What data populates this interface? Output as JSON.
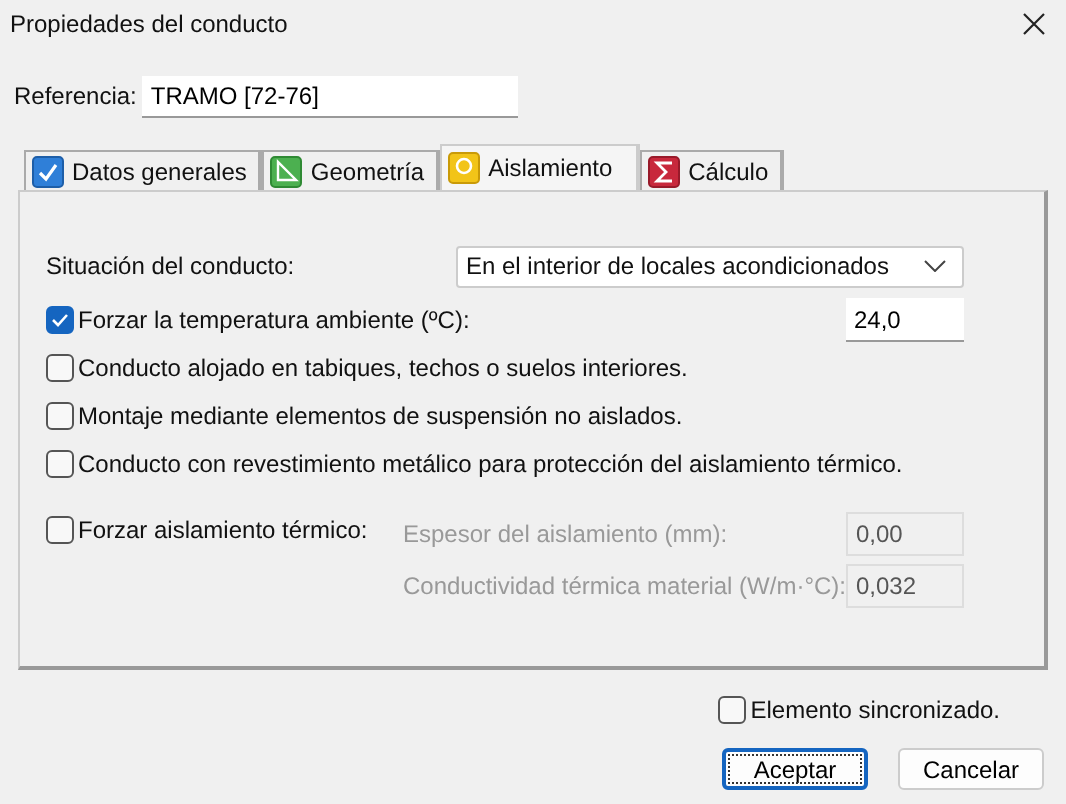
{
  "window": {
    "title": "Propiedades del conducto"
  },
  "reference": {
    "label": "Referencia:",
    "value": "TRAMO [72-76]"
  },
  "tabs": [
    {
      "label": "Datos generales",
      "kind": "check",
      "selected": false
    },
    {
      "label": "Geometría",
      "kind": "geometry",
      "selected": false
    },
    {
      "label": "Aislamiento",
      "kind": "insulation",
      "selected": true
    },
    {
      "label": "Cálculo",
      "kind": "sum",
      "selected": false
    }
  ],
  "situation": {
    "label": "Situación del conducto:",
    "value": "En el interior de locales acondicionados"
  },
  "force_temperature": {
    "label": "Forzar la temperatura ambiente (ºC):",
    "checked": true,
    "value": "24,0"
  },
  "options": [
    {
      "label": "Conducto alojado en tabiques, techos o suelos interiores.",
      "checked": false
    },
    {
      "label": "Montaje mediante elementos de suspensión no aislados.",
      "checked": false
    },
    {
      "label": "Conducto con revestimiento metálico para protección del aislamiento térmico.",
      "checked": false
    }
  ],
  "force_insulation": {
    "label": "Forzar aislamiento térmico:",
    "checked": false,
    "fields": [
      {
        "label": "Espesor del aislamiento (mm):",
        "value": "0,00",
        "disabled": true
      },
      {
        "label": "Conductividad térmica material (W/m·°C):",
        "value": "0,032",
        "disabled": true
      }
    ]
  },
  "synchronized": {
    "label": "Elemento sincronizado.",
    "checked": false
  },
  "buttons": [
    {
      "label": "Aceptar",
      "default": true
    },
    {
      "label": "Cancelar",
      "default": false
    }
  ]
}
